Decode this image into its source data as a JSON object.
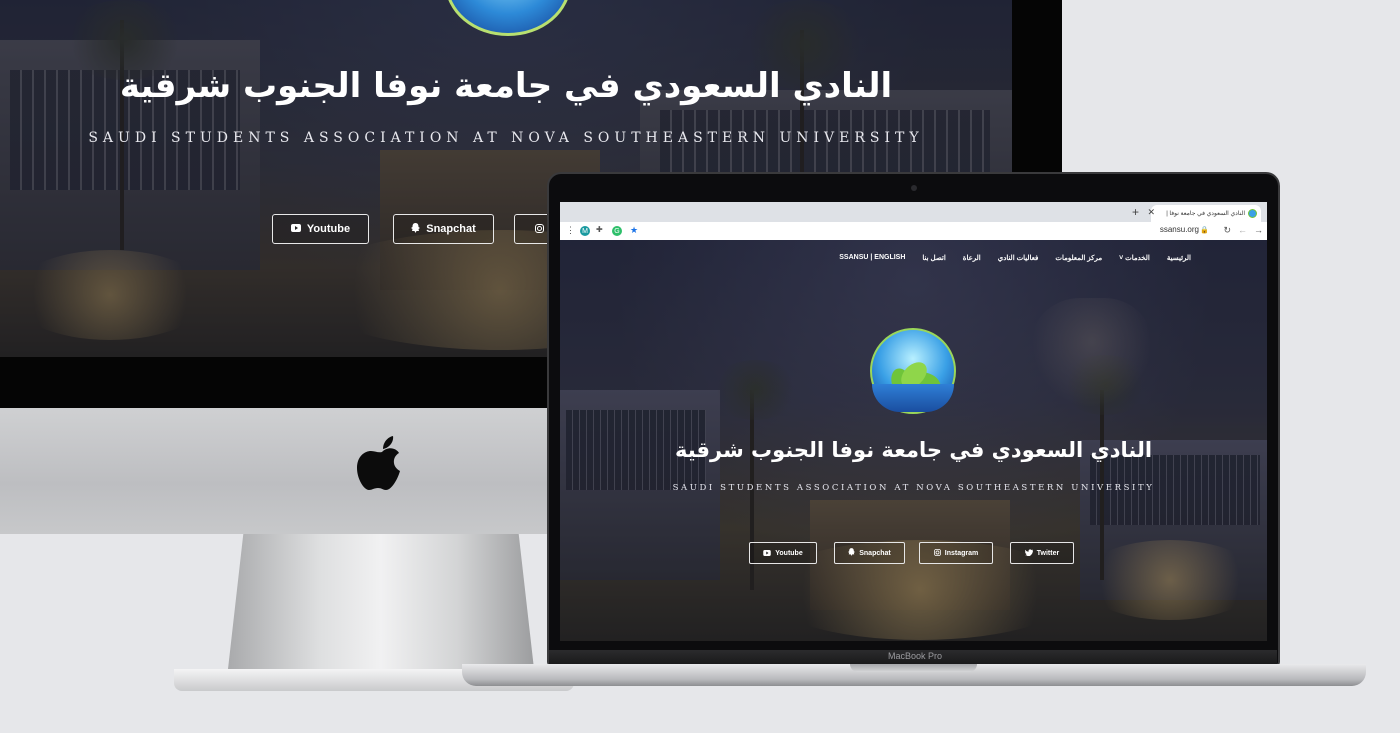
{
  "imac": {
    "title": "النادي السعودي في جامعة نوفا الجنوب شرقية",
    "subtitle": "SAUDI STUDENTS ASSOCIATION AT NOVA SOUTHEASTERN UNIVERSITY",
    "buttons": [
      "Youtube",
      "Snapchat"
    ]
  },
  "macbook": {
    "label": "MacBook Pro",
    "browser": {
      "tab_title": "النادي السعودي في جامعة نوفا |",
      "url": "ssansu.org"
    },
    "site": {
      "nav": [
        "الرئيسية",
        "الخدمات",
        "مركز المعلومات",
        "فعاليات النادي",
        "الرعاة",
        "اتصل بنا",
        "SSANSU | ENGLISH"
      ],
      "title": "النادي السعودي في جامعة نوفا الجنوب شرقية",
      "subtitle": "SAUDI STUDENTS ASSOCIATION AT NOVA SOUTHEASTERN UNIVERSITY",
      "buttons": [
        "Youtube",
        "Snapchat",
        "Instagram",
        "Twitter"
      ]
    }
  },
  "colors": {
    "background": "#e6e7ea",
    "overlay": "#141622",
    "button_border": "#e6e6e6",
    "logo_blue": "#3aa0e6",
    "logo_green": "#6fc43a"
  },
  "icons": {
    "youtube": "youtube-icon",
    "snapchat": "snapchat-icon",
    "instagram": "instagram-icon",
    "twitter": "twitter-icon",
    "apple": "apple-logo-icon"
  }
}
